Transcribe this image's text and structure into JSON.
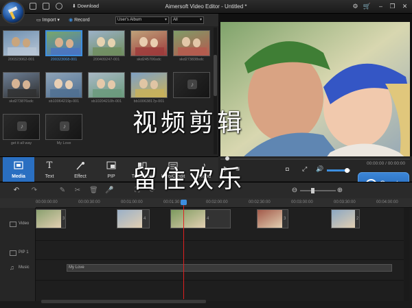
{
  "titlebar": {
    "title": "Aimersoft Video Editor - Untitled *",
    "download_label": "Download",
    "icons": [
      "save-icon",
      "export-icon",
      "help-icon",
      "settings-icon",
      "cart-icon"
    ],
    "window_buttons": [
      "minimize",
      "restore",
      "close"
    ]
  },
  "library": {
    "import_label": "Import",
    "record_label": "Record",
    "album_select": "User's Album",
    "filter_select": "All",
    "items": [
      {
        "label": "200323062-001",
        "selected": false
      },
      {
        "label": "200323068-001",
        "selected": true
      },
      {
        "label": "200409247-001",
        "selected": false
      },
      {
        "label": "skd245706sdc",
        "selected": false
      },
      {
        "label": "skd273838sdc",
        "selected": false
      },
      {
        "label": "skd273876sdc",
        "selected": false
      },
      {
        "label": "sb10064219p-001",
        "selected": false
      },
      {
        "label": "sb10204210h-001",
        "selected": false
      },
      {
        "label": "bb10063817p-001",
        "selected": false
      },
      {
        "label": "",
        "selected": false
      },
      {
        "label": "get it all way",
        "selected": false
      },
      {
        "label": "My Love",
        "selected": false
      }
    ]
  },
  "tabs": [
    {
      "label": "Media",
      "icon": "media-icon",
      "active": true
    },
    {
      "label": "Text",
      "icon": "text-icon",
      "active": false
    },
    {
      "label": "Effect",
      "icon": "effect-icon",
      "active": false
    },
    {
      "label": "PIP",
      "icon": "pip-icon",
      "active": false
    },
    {
      "label": "Transition",
      "icon": "transition-icon",
      "active": false
    },
    {
      "label": "Intro/Credit",
      "icon": "intro-icon",
      "active": false
    },
    {
      "label": "Sound",
      "icon": "sound-icon",
      "active": false
    }
  ],
  "player": {
    "timecode": "00:00:00 / 00:00:00",
    "volume_level": 0.85
  },
  "create_label": "Create",
  "ruler": [
    "00:00:00:00",
    "00:00:30:00",
    "00:01:00:00",
    "00:01:30:00",
    "00:02:00:00",
    "00:02:30:00",
    "00:03:00:00",
    "00:03:30:00",
    "00:04:00:00"
  ],
  "tracks": {
    "video_label": "Video",
    "pip_label": "PIP 1",
    "music_label": "Music",
    "clip_numbers": [
      "3",
      "4",
      "4",
      "3",
      "2"
    ],
    "music_clip": "My Love"
  },
  "overlay_text": {
    "line1": "视频剪辑",
    "line2": "留住欢乐"
  }
}
